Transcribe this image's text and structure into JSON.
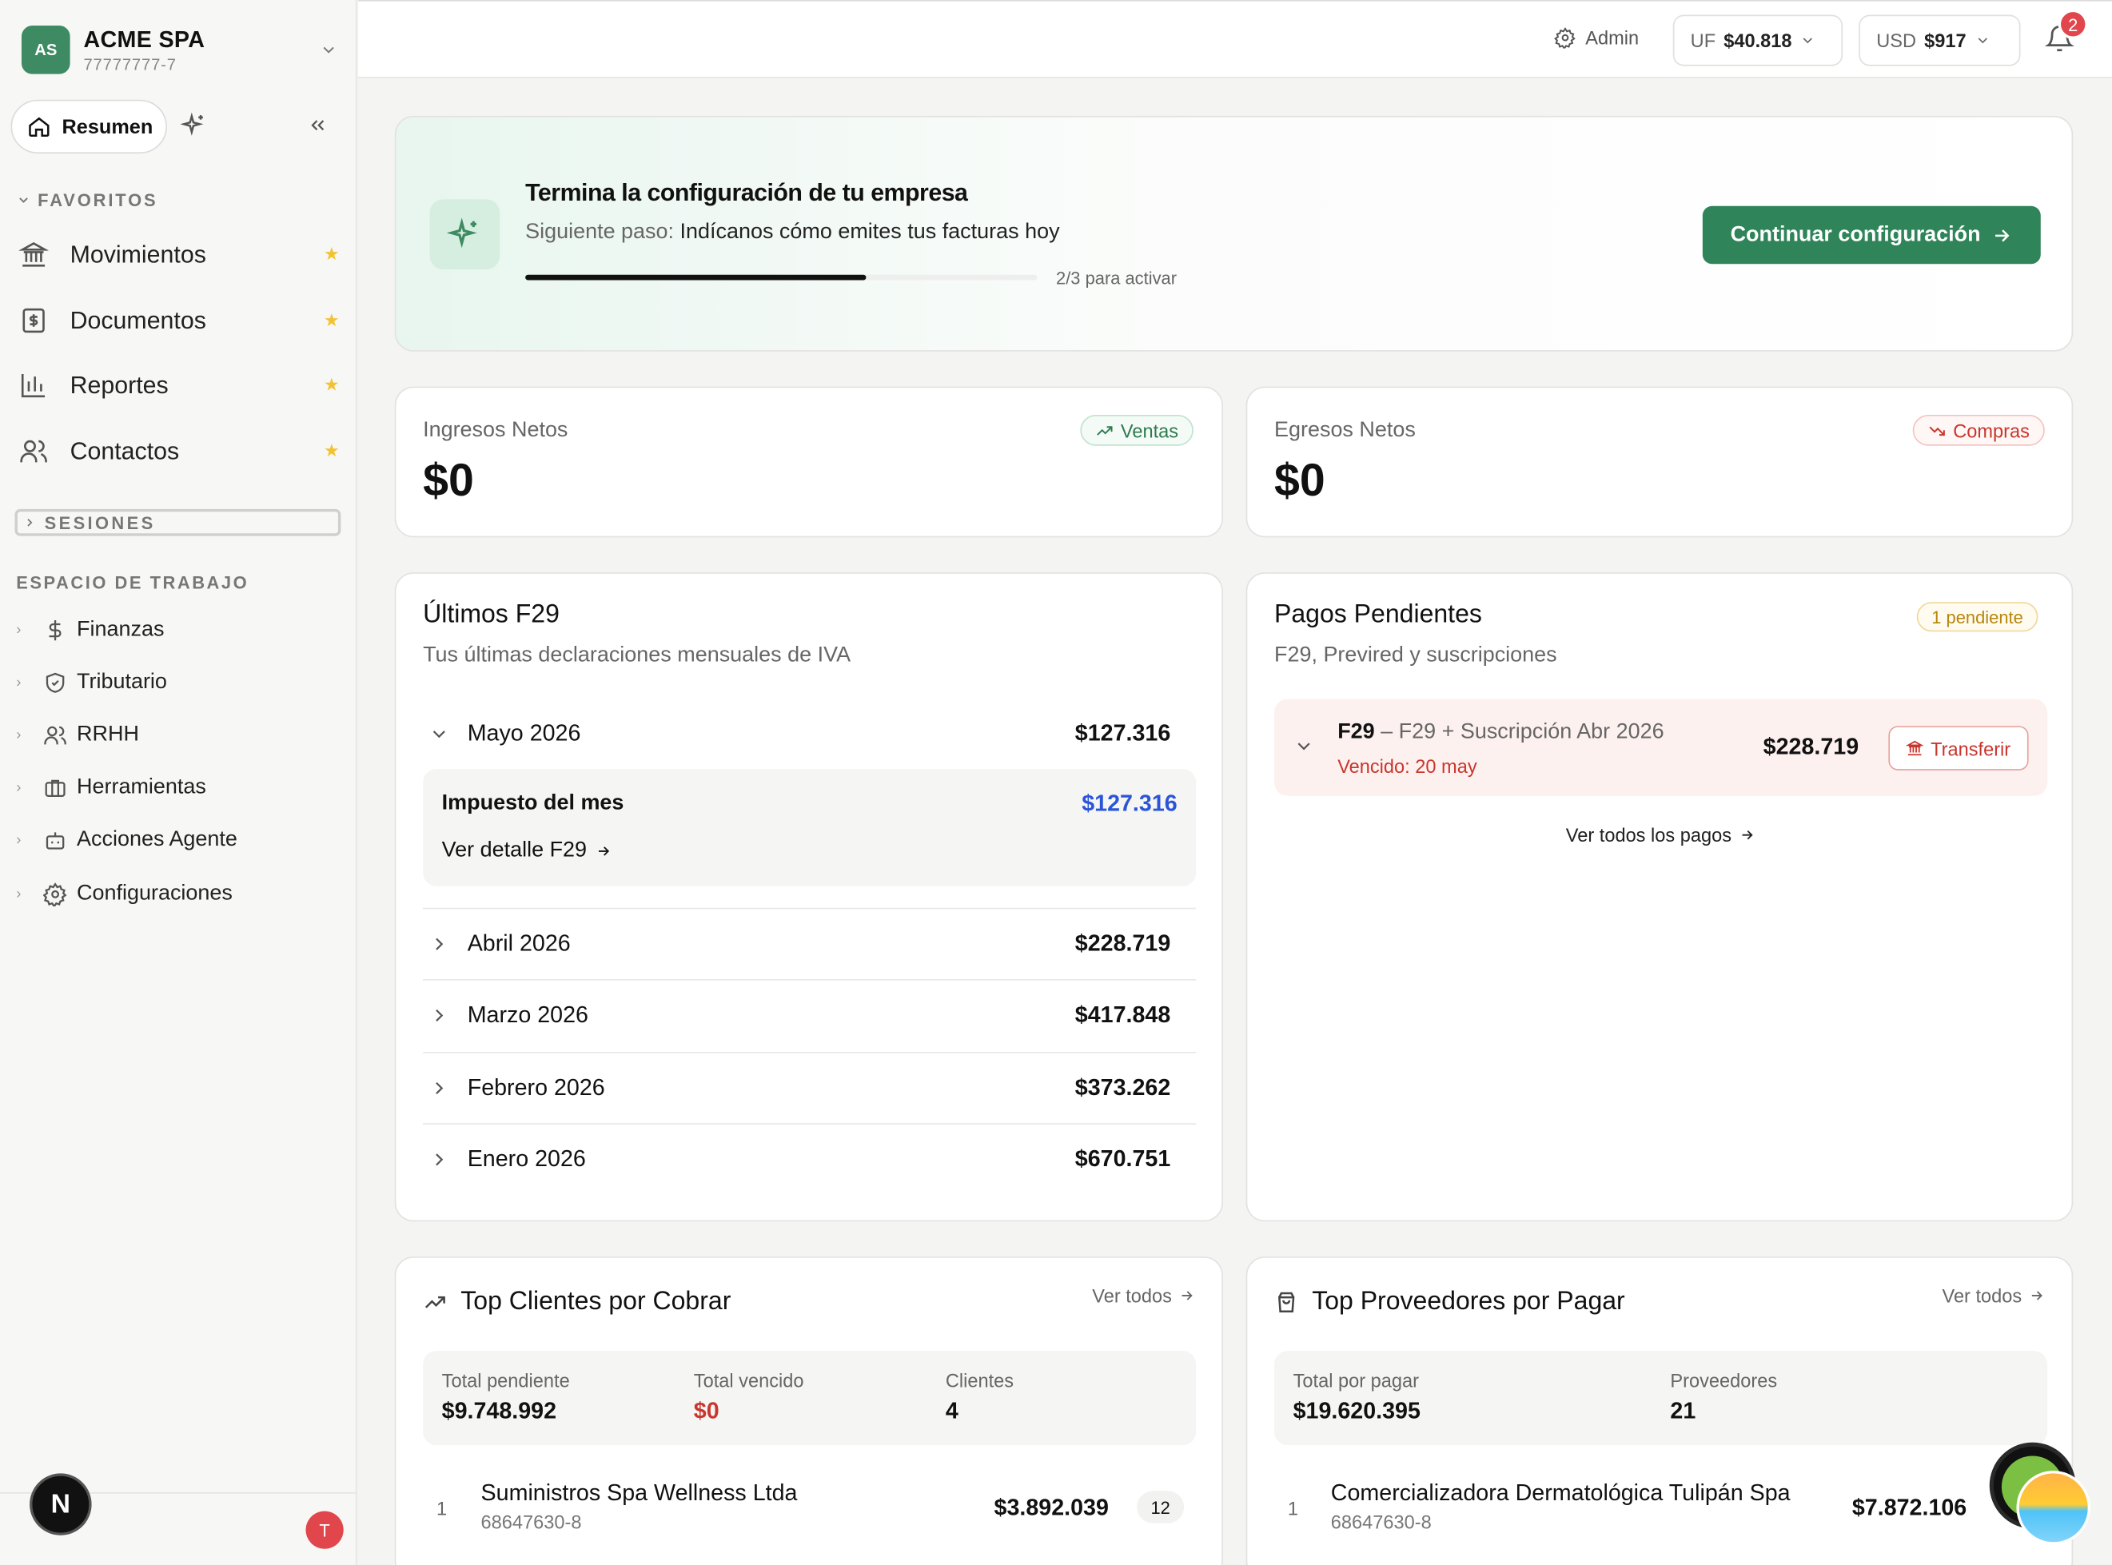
{
  "company": {
    "initials": "AS",
    "name": "ACME SPA",
    "rut": "77777777-7"
  },
  "nav": {
    "resumen": "Resumen"
  },
  "favorites": {
    "label": "FAVORITOS",
    "items": [
      {
        "label": "Movimientos"
      },
      {
        "label": "Documentos"
      },
      {
        "label": "Reportes"
      },
      {
        "label": "Contactos"
      }
    ]
  },
  "sessions": {
    "label": "SESIONES"
  },
  "workspace": {
    "label": "ESPACIO DE TRABAJO",
    "items": [
      {
        "label": "Finanzas"
      },
      {
        "label": "Tributario"
      },
      {
        "label": "RRHH"
      },
      {
        "label": "Herramientas"
      },
      {
        "label": "Acciones Agente"
      },
      {
        "label": "Configuraciones"
      }
    ]
  },
  "user": {
    "badge": "N",
    "initial": "T"
  },
  "header": {
    "admin": "Admin",
    "uf_label": "UF",
    "uf_value": "$40.818",
    "usd_label": "USD",
    "usd_value": "$917",
    "notifications": "2"
  },
  "onboarding": {
    "title": "Termina la configuración de tu empresa",
    "step_prefix": "Siguiente paso:",
    "step": "Indícanos cómo emites tus facturas hoy",
    "progress": 0.667,
    "count": "2/3 para activar",
    "button": "Continuar configuración"
  },
  "ingresos": {
    "label": "Ingresos Netos",
    "value": "$0",
    "tag": "Ventas"
  },
  "egresos": {
    "label": "Egresos Netos",
    "value": "$0",
    "tag": "Compras"
  },
  "f29": {
    "title": "Últimos F29",
    "subtitle": "Tus últimas declaraciones mensuales de IVA",
    "open": {
      "month": "Mayo 2026",
      "amount": "$127.316",
      "tax_label": "Impuesto del mes",
      "tax_amount": "$127.316",
      "detail": "Ver detalle F29"
    },
    "rows": [
      {
        "month": "Abril 2026",
        "amount": "$228.719"
      },
      {
        "month": "Marzo 2026",
        "amount": "$417.848"
      },
      {
        "month": "Febrero 2026",
        "amount": "$373.262"
      },
      {
        "month": "Enero 2026",
        "amount": "$670.751"
      }
    ]
  },
  "pagos": {
    "title": "Pagos Pendientes",
    "subtitle": "F29, Previred y suscripciones",
    "badge": "1 pendiente",
    "item": {
      "code": "F29",
      "desc": "– F29 + Suscripción Abr 2026",
      "due": "Vencido: 20 may",
      "amount": "$228.719",
      "action": "Transferir"
    },
    "see_all": "Ver todos los pagos"
  },
  "clientes": {
    "title": "Top Clientes por Cobrar",
    "see_all": "Ver todos",
    "stats": [
      {
        "label": "Total pendiente",
        "value": "$9.748.992"
      },
      {
        "label": "Total vencido",
        "value": "$0"
      },
      {
        "label": "Clientes",
        "value": "4"
      }
    ],
    "rows": [
      {
        "rank": "1",
        "name": "Suministros Spa Wellness Ltda",
        "rut": "68647630-8",
        "amount": "$3.892.039",
        "count": "12"
      }
    ]
  },
  "proveedores": {
    "title": "Top Proveedores por Pagar",
    "see_all": "Ver todos",
    "stats": [
      {
        "label": "Total por pagar",
        "value": "$19.620.395"
      },
      {
        "label": "Proveedores",
        "value": "21"
      }
    ],
    "rows": [
      {
        "rank": "1",
        "name": "Comercializadora Dermatológica Tulipán Spa",
        "rut": "68647630-8",
        "amount": "$7.872.106"
      }
    ]
  },
  "colors": {
    "brand": "#2f8459",
    "danger": "#c9362d",
    "link_blue": "#2b55d8",
    "star": "#f2c230"
  }
}
